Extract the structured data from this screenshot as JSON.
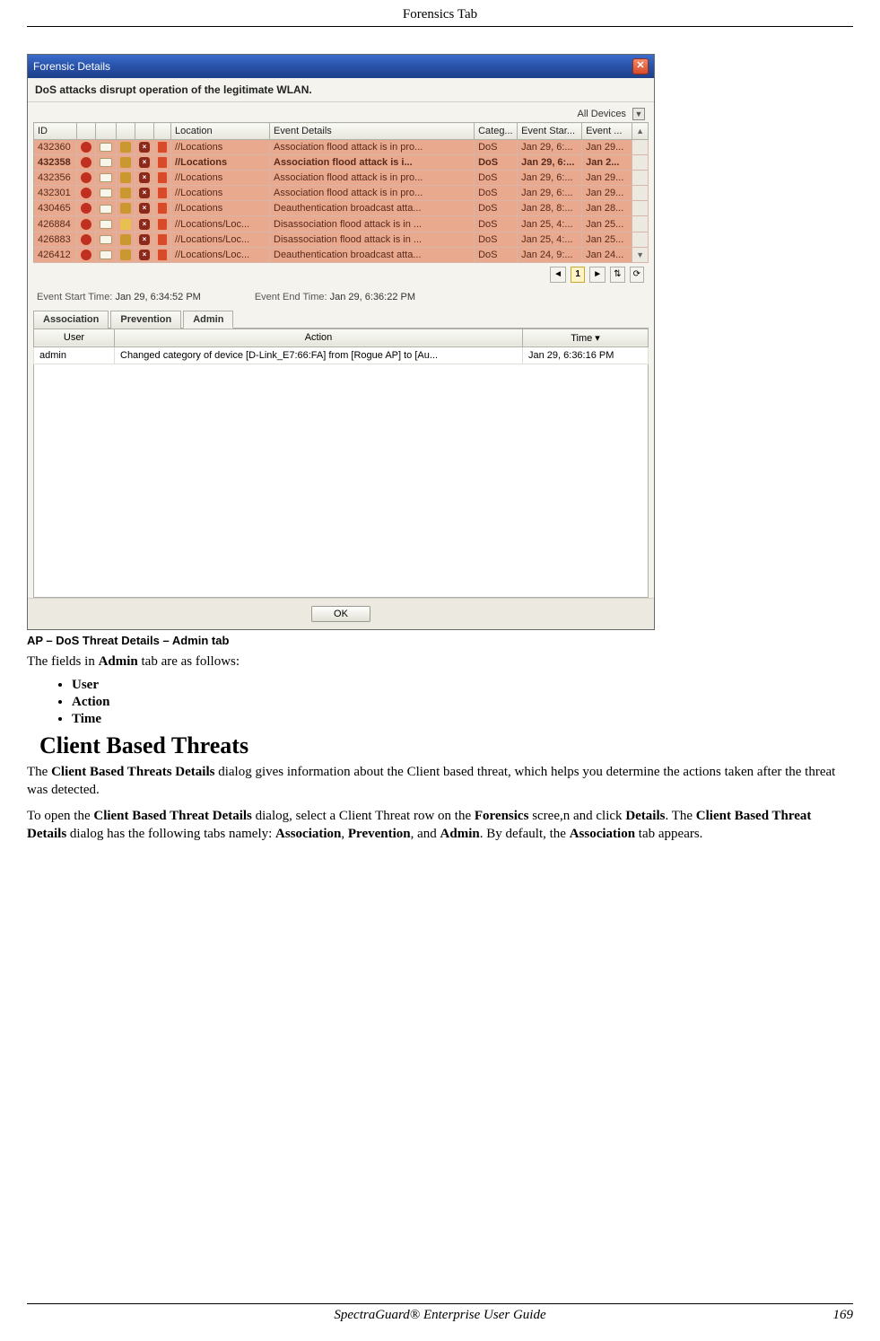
{
  "page_header": "Forensics Tab",
  "footer": {
    "center": "SpectraGuard® Enterprise User Guide",
    "right": "169"
  },
  "dialog": {
    "title": "Forensic Details",
    "description": "DoS attacks disrupt operation of the legitimate WLAN.",
    "filter_label": "All Devices",
    "columns": {
      "id": "ID",
      "location": "Location",
      "event_details": "Event Details",
      "category": "Categ...",
      "event_start": "Event Star...",
      "event_end": "Event ..."
    },
    "rows": [
      {
        "id": "432360",
        "loc": "//Locations",
        "det": "Association flood attack is in pro...",
        "cat": "DoS",
        "start": "Jan 29, 6:...",
        "end": "Jan 29...",
        "bold": false
      },
      {
        "id": "432358",
        "loc": "//Locations",
        "det": "Association flood attack is i...",
        "cat": "DoS",
        "start": "Jan 29, 6:...",
        "end": "Jan 2...",
        "bold": true
      },
      {
        "id": "432356",
        "loc": "//Locations",
        "det": "Association flood attack is in pro...",
        "cat": "DoS",
        "start": "Jan 29, 6:...",
        "end": "Jan 29...",
        "bold": false
      },
      {
        "id": "432301",
        "loc": "//Locations",
        "det": "Association flood attack is in pro...",
        "cat": "DoS",
        "start": "Jan 29, 6:...",
        "end": "Jan 29...",
        "bold": false
      },
      {
        "id": "430465",
        "loc": "//Locations",
        "det": "Deauthentication broadcast atta...",
        "cat": "DoS",
        "start": "Jan 28, 8:...",
        "end": "Jan 28...",
        "bold": false
      },
      {
        "id": "426884",
        "loc": "//Locations/Loc...",
        "det": "Disassociation flood attack is in ...",
        "cat": "DoS",
        "start": "Jan 25, 4:...",
        "end": "Jan 25...",
        "bold": false
      },
      {
        "id": "426883",
        "loc": "//Locations/Loc...",
        "det": "Disassociation flood attack is in ...",
        "cat": "DoS",
        "start": "Jan 25, 4:...",
        "end": "Jan 25...",
        "bold": false
      },
      {
        "id": "426412",
        "loc": "//Locations/Loc...",
        "det": "Deauthentication broadcast atta...",
        "cat": "DoS",
        "start": "Jan 24, 9:...",
        "end": "Jan 24...",
        "bold": false
      }
    ],
    "pager": {
      "prev": "◄",
      "page": "1",
      "next": "►",
      "extra1": "⇅",
      "extra2": "⟳"
    },
    "start_time_label": "Event Start Time:",
    "start_time_value": "Jan 29, 6:34:52 PM",
    "end_time_label": "Event End Time:",
    "end_time_value": "Jan 29, 6:36:22 PM",
    "subtabs": {
      "assoc": "Association",
      "prev": "Prevention",
      "admin": "Admin"
    },
    "sub_columns": {
      "user": "User",
      "action": "Action",
      "time": "Time ▾"
    },
    "sub_rows": [
      {
        "user": "admin",
        "action": "Changed category of device [D-Link_E7:66:FA] from [Rogue AP] to [Au...",
        "time": "Jan 29, 6:36:16 PM"
      }
    ],
    "ok_label": "OK"
  },
  "caption": "AP – DoS Threat Details – Admin tab",
  "intro_text_pre": "The fields in ",
  "intro_text_bold": "Admin",
  "intro_text_post": " tab are as follows:",
  "fields": [
    "User",
    "Action",
    "Time"
  ],
  "section_heading": "Client Based Threats",
  "para1_parts": {
    "a": "The ",
    "b": "Client Based Threats Details",
    "c": " dialog gives information about the Client based threat, which helps you determine the actions taken after the threat was detected."
  },
  "para2_parts": {
    "a": "To open the ",
    "b": "Client Based Threat Details",
    "c": " dialog, select a Client Threat row on the ",
    "d": "Forensics",
    "e": " scree,n and click ",
    "f": "Details",
    "g": ". The ",
    "h": "Client Based Threat Details",
    "i": " dialog has the following tabs namely: ",
    "j": "Association",
    "k": ", ",
    "l": "Prevention",
    "m": ", and ",
    "n": "Admin",
    "o": ". By default, the ",
    "p": "Association",
    "q": " tab appears."
  }
}
